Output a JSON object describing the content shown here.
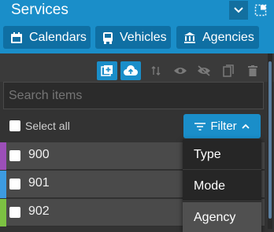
{
  "header": {
    "title": "Services"
  },
  "nav": [
    {
      "label": "Calendars",
      "icon": "calendar-icon"
    },
    {
      "label": "Vehicles",
      "icon": "bus-icon"
    },
    {
      "label": "Agencies",
      "icon": "bank-icon"
    }
  ],
  "actions": [
    "add-icon",
    "upload-icon",
    "sort-icon",
    "eye-icon",
    "eye-off-icon",
    "copy-icon",
    "trash-icon"
  ],
  "search": {
    "placeholder": "Search items"
  },
  "select_all": {
    "label": "Select all"
  },
  "filter": {
    "label": "Filter"
  },
  "items": [
    {
      "label": "900",
      "color": "#9c4fb8"
    },
    {
      "label": "901",
      "color": "#3d9be0"
    },
    {
      "label": "902",
      "color": "#7cc142"
    }
  ],
  "filter_menu": [
    {
      "label": "Type",
      "selected": false
    },
    {
      "label": "Mode",
      "selected": false
    },
    {
      "label": "Agency",
      "selected": true
    }
  ],
  "colors": {
    "accent": "#1a8ec9",
    "accent_dark": "#0f6fa3",
    "panel": "#333333"
  }
}
